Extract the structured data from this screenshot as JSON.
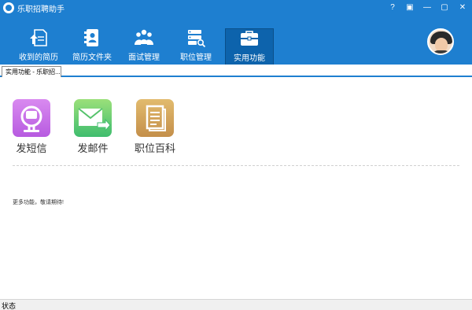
{
  "window": {
    "title": "乐职招聘助手",
    "controls": [
      "?",
      "▣",
      "—",
      "▢",
      "✕"
    ],
    "colors": {
      "primary": "#1e7fd0",
      "active": "#0d63ac"
    }
  },
  "nav": {
    "items": [
      {
        "label": "收到的简历",
        "icon": "resume-upload-icon"
      },
      {
        "label": "简历文件夹",
        "icon": "contact-folder-icon"
      },
      {
        "label": "面试管理",
        "icon": "people-group-icon"
      },
      {
        "label": "职位管理",
        "icon": "server-search-icon"
      },
      {
        "label": "实用功能",
        "icon": "briefcase-icon",
        "active": true
      }
    ]
  },
  "tab": {
    "label": "实用功能 - 乐职招..."
  },
  "tools": [
    {
      "label": "发短信",
      "icon": "sms-icon",
      "color": "#c46ae6"
    },
    {
      "label": "发邮件",
      "icon": "email-send-icon",
      "color": "#55c26b"
    },
    {
      "label": "职位百科",
      "icon": "document-icon",
      "color": "#cfa45a"
    }
  ],
  "more_text": "更多功能，敬请期待!",
  "status": {
    "label": "状态"
  }
}
